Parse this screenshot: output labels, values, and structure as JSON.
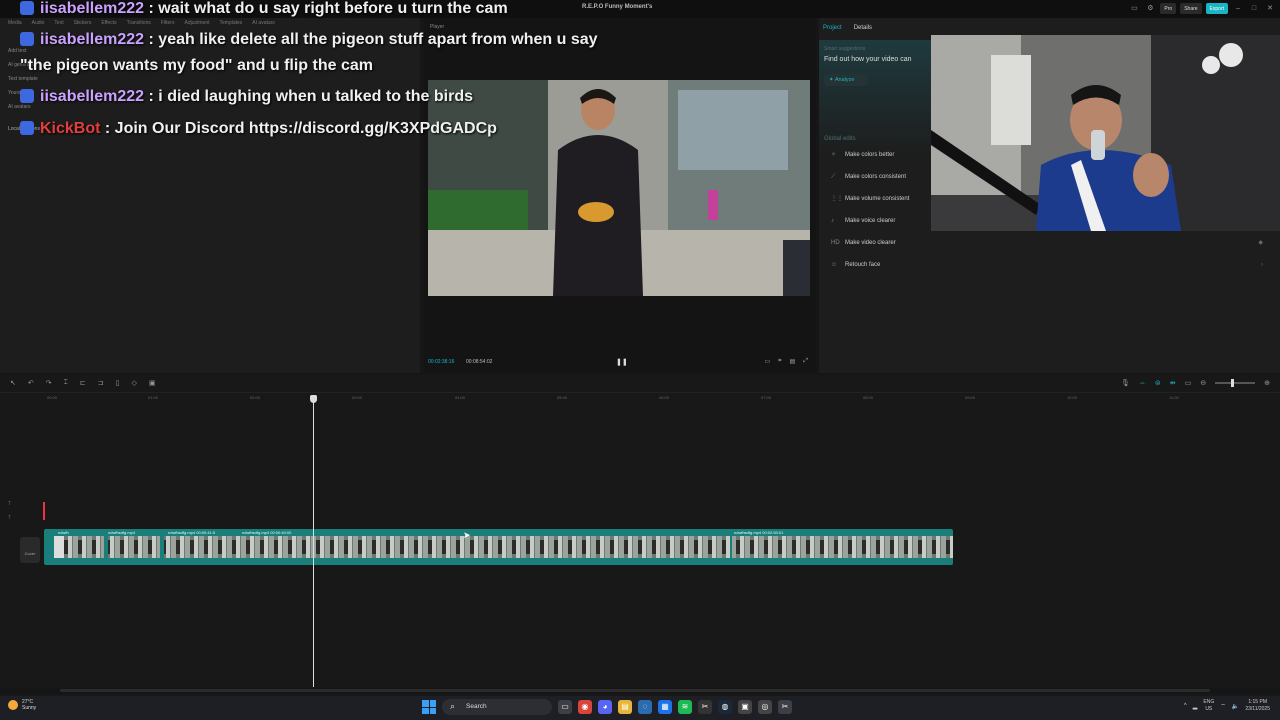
{
  "window": {
    "title": "R.E.P.O Funny Moment's",
    "pro_label": "Pro",
    "share_label": "Share",
    "export_label": "Export"
  },
  "toolbar": [
    "Media",
    "Audio",
    "Text",
    "Stickers",
    "Effects",
    "Transitions",
    "Filters",
    "Adjustment",
    "Templates",
    "AI avatars"
  ],
  "left_nav": [
    "Add text",
    "AI generated",
    "Text template",
    "Yours",
    "AI avatars",
    "Local captions"
  ],
  "chat": [
    {
      "badge": true,
      "name": "iisabellem222",
      "message": ": wait what do u say right before u turn the cam"
    },
    {
      "badge": true,
      "name": "iisabellem222",
      "message": ": yeah like delete all the pigeon stuff apart from when u say"
    },
    {
      "continuation": "\"the pigeon wants my food\" and u flip the cam"
    },
    {
      "badge": true,
      "name": "iisabellem222",
      "message": ": i died laughing when u talked to the birds"
    },
    {
      "badge": true,
      "name": "KickBot",
      "bot": true,
      "message": ": Join Our Discord https://discord.gg/K3XPdGADCp"
    }
  ],
  "player": {
    "label": "Player",
    "current_time": "00:02:38:16",
    "total_time": "00:08:54:02"
  },
  "right_panel": {
    "tabs": [
      "Project",
      "Details"
    ],
    "smart_title": "Smart suggestions",
    "smart_text": "Find out how your video can",
    "analyze_label": "Analyze",
    "global_edits_label": "Global edits",
    "edits": [
      {
        "label": "Make colors better",
        "icon": "sparkle-icon"
      },
      {
        "label": "Make colors consistent",
        "icon": "wand-icon"
      },
      {
        "label": "Make volume consistent",
        "icon": "volume-icon"
      },
      {
        "label": "Make voice clearer",
        "icon": "voice-icon"
      },
      {
        "label": "Make video clearer",
        "icon": "hd-icon"
      },
      {
        "label": "Retouch face",
        "icon": "face-icon"
      }
    ]
  },
  "timeline": {
    "ruler": [
      "00:00",
      "01:00",
      "02:00",
      "03:00",
      "04:00",
      "05:00",
      "06:00",
      "07:00",
      "08:00",
      "09:00",
      "10:00",
      "11:00"
    ],
    "cover_label": "Cover",
    "clip_labels": [
      "ndwfh",
      "ndwfhsdfg.mp4",
      "ndwfhsdfg.mp4  00:00:41:5",
      "ndwfhsdfg.mp4  00:00:40:00",
      "ndwfhsdfg.mp4  00:02:50:01"
    ]
  },
  "taskbar": {
    "temp": "27°C",
    "weather": "Sunny",
    "search_placeholder": "Search",
    "lang_line1": "ENG",
    "lang_line2": "US",
    "time": "1:15 PM",
    "date": "23/11/2025"
  },
  "colors": {
    "accent": "#19b5c4",
    "chat_name": "#c9a3ff",
    "bot_name": "#e33d3d",
    "clip": "#1a7e7a"
  }
}
